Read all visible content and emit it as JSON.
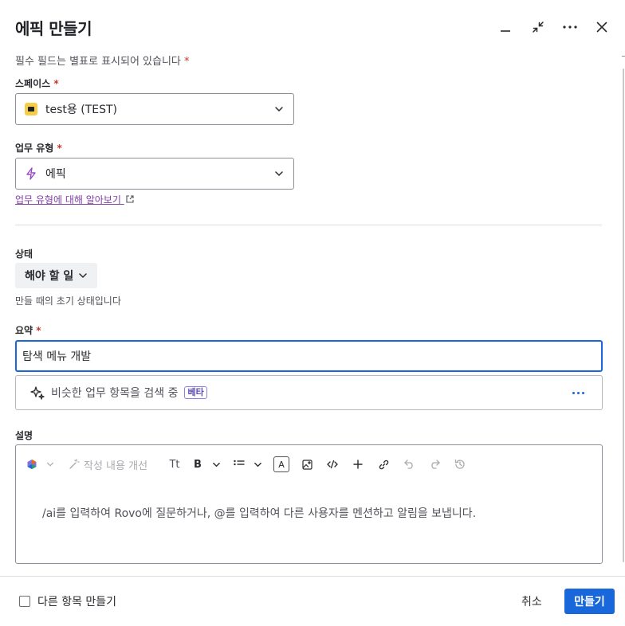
{
  "header": {
    "title": "에픽 만들기",
    "icons": [
      "minimize-icon",
      "collapse-icon",
      "more-icon",
      "close-icon"
    ]
  },
  "required_note": "필수 필드는 별표로 표시되어 있습니다",
  "required_mark": "*",
  "space": {
    "label": "스페이스",
    "value": "test용 (TEST)",
    "icon": "space-avatar-icon"
  },
  "work_type": {
    "label": "업무 유형",
    "value": "에픽",
    "icon": "epic-lightning-icon",
    "learn_link": "업무 유형에 대해 알아보기"
  },
  "status": {
    "label": "상태",
    "value": "해야 할 일",
    "helper": "만들 때의 초기 상태입니다"
  },
  "summary": {
    "label": "요약",
    "value": "탐색 메뉴 개발"
  },
  "similar": {
    "text": "비슷한 업무 항목을 검색 중",
    "badge": "베타"
  },
  "description": {
    "label": "설명",
    "toolbar": {
      "improve": "작성 내용 개선",
      "text_style": "Tt",
      "bold": "B",
      "text_color": "A"
    },
    "placeholder": "/ai를 입력하여 Rovo에 질문하거나, @를 입력하여 다른 사용자를 멘션하고 알림을 보냅니다."
  },
  "footer": {
    "create_another": "다른 항목 만들기",
    "cancel": "취소",
    "create": "만들기"
  },
  "colors": {
    "accent": "#1868db",
    "required": "#c9372c",
    "link": "#803fa5",
    "space_icon": "#f5cd47"
  }
}
